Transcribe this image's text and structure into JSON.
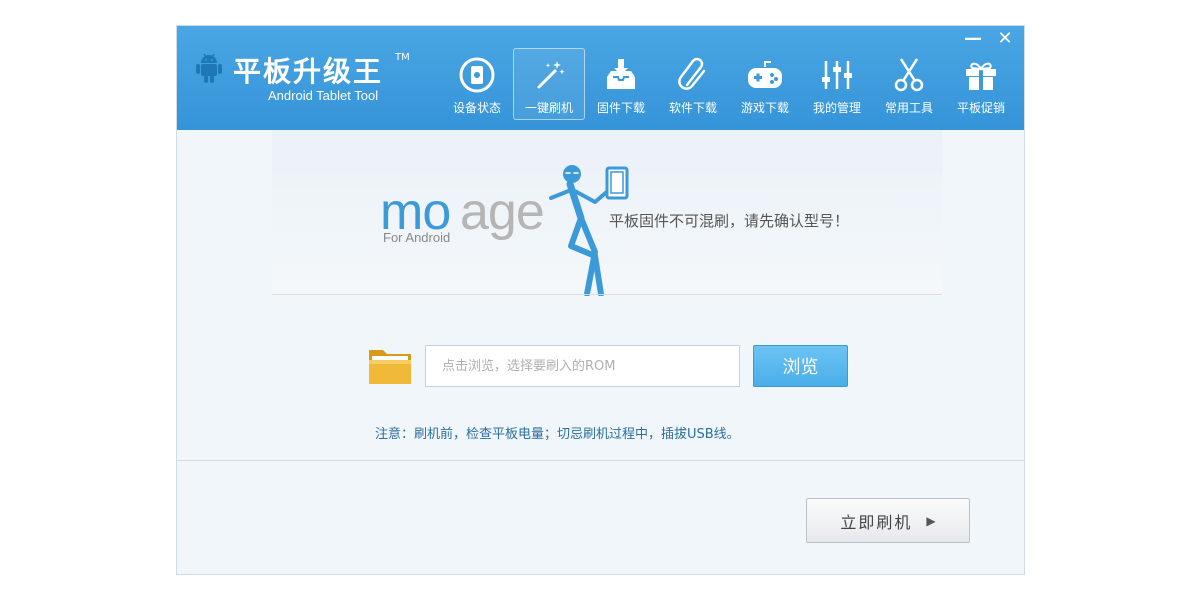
{
  "app": {
    "title": "平板升级王",
    "trademark": "TM",
    "subtitle": "Android Tablet Tool"
  },
  "window_controls": {
    "minimize": "—",
    "close": "✕"
  },
  "nav": {
    "items": [
      {
        "label": "设备状态",
        "icon": "device-status-icon",
        "active": false
      },
      {
        "label": "一键刷机",
        "icon": "magic-wand-icon",
        "active": true
      },
      {
        "label": "固件下载",
        "icon": "firmware-download-icon",
        "active": false
      },
      {
        "label": "软件下载",
        "icon": "paperclip-icon",
        "active": false
      },
      {
        "label": "游戏下载",
        "icon": "gamepad-icon",
        "active": false
      },
      {
        "label": "我的管理",
        "icon": "sliders-icon",
        "active": false
      },
      {
        "label": "常用工具",
        "icon": "scissors-icon",
        "active": false
      },
      {
        "label": "平板促销",
        "icon": "gift-icon",
        "active": false
      }
    ]
  },
  "logo": {
    "part1": "mo",
    "part2": "age",
    "sub": "For Android"
  },
  "main": {
    "tagline": "平板固件不可混刷，请先确认型号！",
    "rom_input": {
      "value": "",
      "placeholder": "点击浏览，选择要刷入的ROM"
    },
    "browse_label": "浏览",
    "notice": "注意：刷机前，检查平板电量；切忌刷机过程中，插拔USB线。",
    "flash_label": "立即刷机",
    "flash_icon": "▶"
  },
  "colors": {
    "titlebar": "#3a9ada",
    "accent": "#4aaeea",
    "logo_blue": "#3d9ad8",
    "notice_text": "#2a6f9d"
  }
}
